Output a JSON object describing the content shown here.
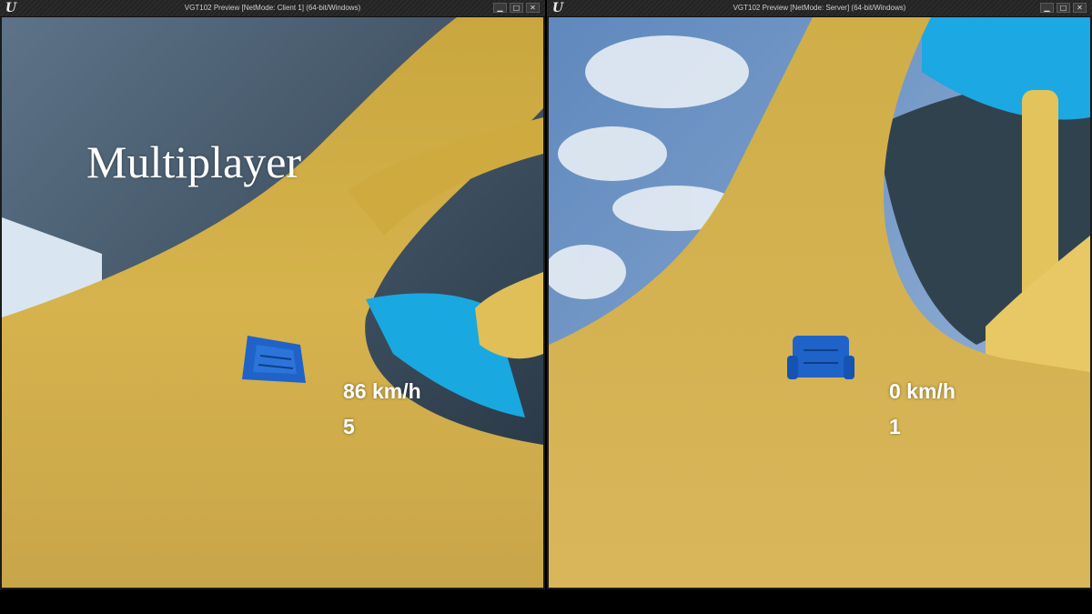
{
  "windows": {
    "client": {
      "title": "VGT102 Preview [NetMode: Client 1]  (64-bit/Windows)",
      "hud": {
        "speed": "86 km/h",
        "position": "5"
      }
    },
    "server": {
      "title": "VGT102 Preview [NetMode: Server]  (64-bit/Windows)",
      "hud": {
        "speed": "0 km/h",
        "position": "1"
      }
    }
  },
  "overlay": {
    "title": "Multiplayer"
  },
  "window_controls": {
    "minimize": "▁",
    "maximize": "□",
    "close": "✕"
  },
  "icons": {
    "app_logo": "unreal-engine-logo-icon"
  },
  "colors": {
    "track": "#d8b64e",
    "track_shadow": "#9c7d25",
    "water": "#2f3f4f",
    "cyan_structure": "#1aa8e0",
    "kart": "#1f63c9",
    "sky": "#6f95c7"
  }
}
